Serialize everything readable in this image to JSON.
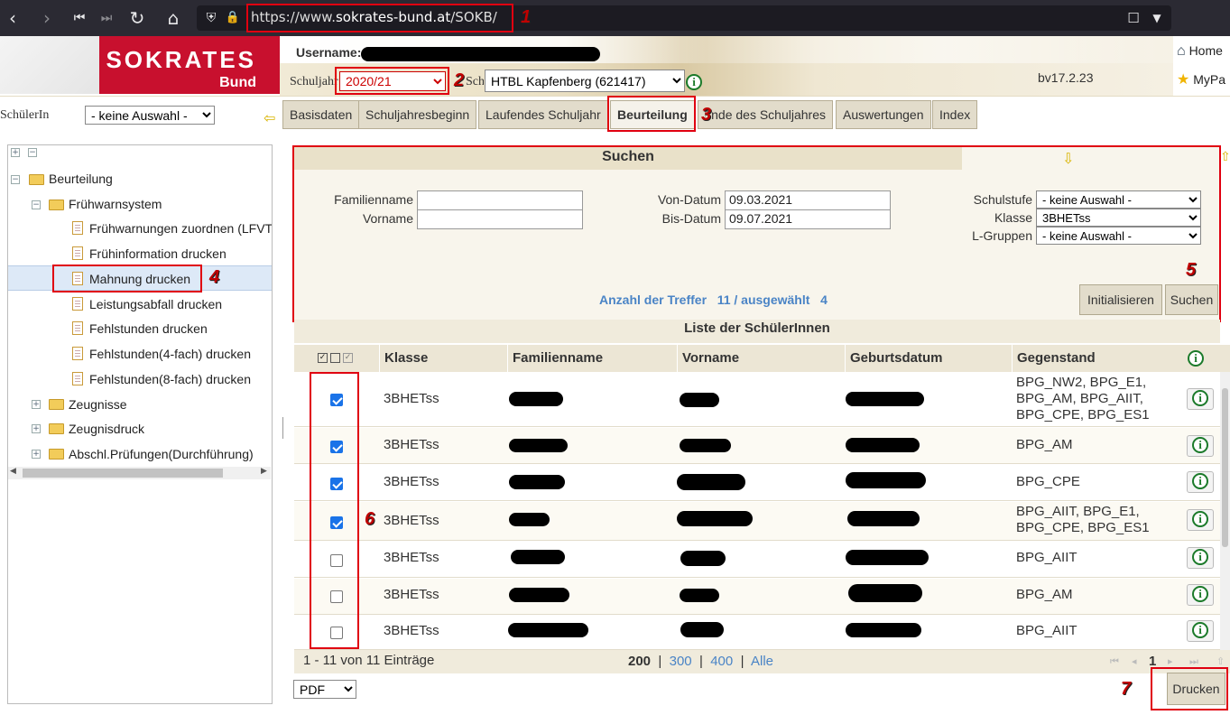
{
  "browser": {
    "url_prefix": "https://www.",
    "url_domain": "sokrates-bund.at",
    "url_path": "/SOKB/"
  },
  "logo": {
    "title": "SOKRATES",
    "subtitle": "Bund"
  },
  "header": {
    "username_label": "Username:",
    "schuljahr_label": "Schuljahr",
    "schuljahr_value": "2020/21",
    "schule_label": "Schule",
    "schule_value": "HTBL Kapfenberg (621417)",
    "version": "bv17.2.23",
    "home_label": "Home",
    "mypage_label": "MyPa"
  },
  "student_selector": {
    "label": "SchülerIn",
    "value": "- keine Auswahl -"
  },
  "tabs": [
    "Basisdaten",
    "Schuljahresbeginn",
    "Laufendes Schuljahr",
    "Beurteilung",
    "Ende des Schuljahres",
    "Auswertungen",
    "Index"
  ],
  "tree": {
    "root": "Beurteilung",
    "folder": "Frühwarnsystem",
    "items": [
      "Frühwarnungen zuordnen (LFVT",
      "Frühinformation drucken",
      "Mahnung drucken",
      "Leistungsabfall drucken",
      "Fehlstunden drucken",
      "Fehlstunden(4-fach) drucken",
      "Fehlstunden(8-fach) drucken"
    ],
    "other_folders": [
      "Zeugnisse",
      "Zeugnisdruck",
      "Abschl.Prüfungen(Durchführung)"
    ]
  },
  "search": {
    "title": "Suchen",
    "familienname_label": "Familienname",
    "vorname_label": "Vorname",
    "von_label": "Von-Datum",
    "von_value": "09.03.2021",
    "bis_label": "Bis-Datum",
    "bis_value": "09.07.2021",
    "schulstufe_label": "Schulstufe",
    "schulstufe_value": "- keine Auswahl -",
    "klasse_label": "Klasse",
    "klasse_value": "3BHETss",
    "lgruppen_label": "L-Gruppen",
    "lgruppen_value": "- keine Auswahl -",
    "treffer_label": "Anzahl der Treffer",
    "treffer_value": "11 / ausgewählt",
    "ausgewaehlt_value": "4",
    "init_button": "Initialisieren",
    "search_button": "Suchen"
  },
  "list": {
    "title": "Liste der SchülerInnen",
    "columns": [
      "Klasse",
      "Familienname",
      "Vorname",
      "Geburtsdatum",
      "Gegenstand"
    ],
    "rows": [
      {
        "checked": true,
        "klasse": "3BHETss",
        "gegenstand": "BPG_NW2, BPG_E1, BPG_AM, BPG_AIIT, BPG_CPE, BPG_ES1"
      },
      {
        "checked": true,
        "klasse": "3BHETss",
        "gegenstand": "BPG_AM"
      },
      {
        "checked": true,
        "klasse": "3BHETss",
        "gegenstand": "BPG_CPE"
      },
      {
        "checked": true,
        "klasse": "3BHETss",
        "gegenstand": "BPG_AIIT, BPG_E1, BPG_CPE, BPG_ES1"
      },
      {
        "checked": false,
        "klasse": "3BHETss",
        "gegenstand": "BPG_AIIT"
      },
      {
        "checked": false,
        "klasse": "3BHETss",
        "gegenstand": "BPG_AM"
      },
      {
        "checked": false,
        "klasse": "3BHETss",
        "gegenstand": "BPG_AIIT"
      }
    ]
  },
  "footer": {
    "range": "1 - 11 von 11 Einträge",
    "page_sizes": [
      "200",
      "300",
      "400",
      "Alle"
    ],
    "page": "1",
    "format": "PDF",
    "print_button": "Drucken"
  },
  "annotations": [
    "1",
    "2",
    "3",
    "4",
    "5",
    "6",
    "7"
  ],
  "colors": {
    "accent_red": "#c8102e",
    "highlight_box": "#e00010",
    "tab_bg": "#e2dccb",
    "info_green": "#1b7a2a",
    "link_blue": "#4a84c6"
  }
}
